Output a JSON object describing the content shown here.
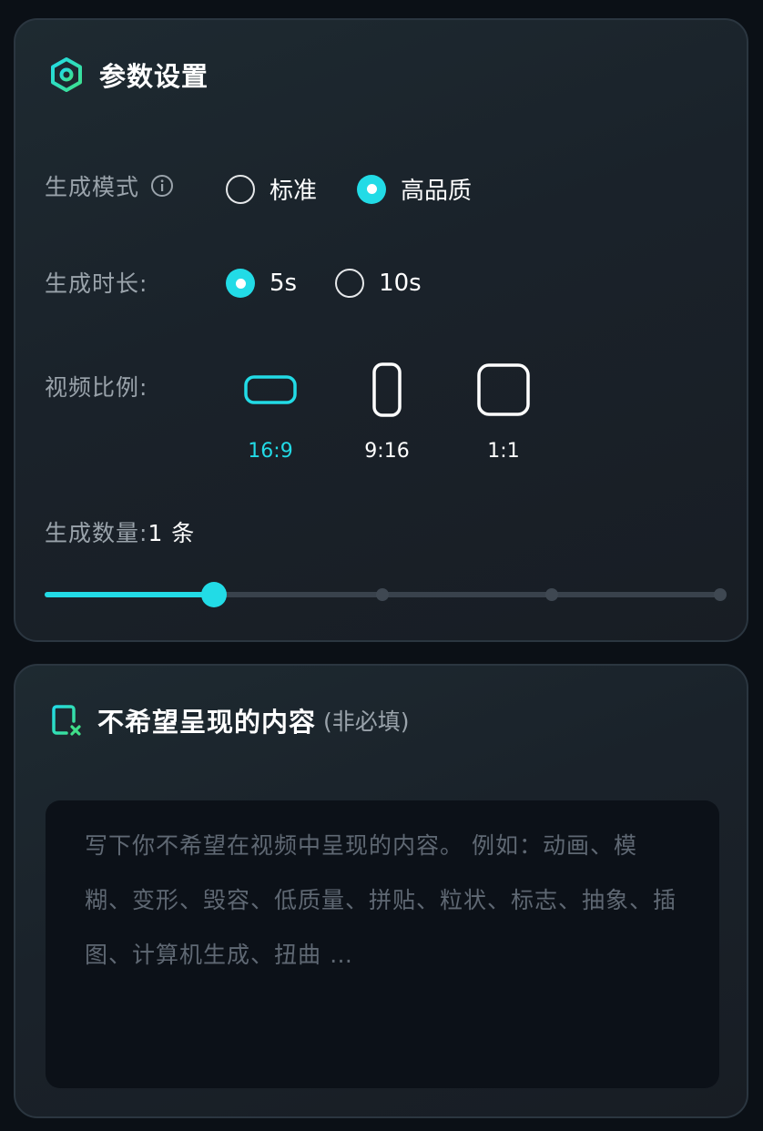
{
  "params": {
    "title": "参数设置",
    "mode": {
      "label": "生成模式",
      "options": [
        "标准",
        "高品质"
      ],
      "selected": "高品质"
    },
    "duration": {
      "label": "生成时长:",
      "options": [
        "5s",
        "10s"
      ],
      "selected": "5s"
    },
    "aspect_ratio": {
      "label": "视频比例:",
      "options": [
        "16:9",
        "9:16",
        "1:1"
      ],
      "selected": "16:9"
    },
    "count": {
      "label": "生成数量:",
      "value": "1 条",
      "slider_steps": 5,
      "slider_index": 1
    }
  },
  "negative": {
    "title": "不希望呈现的内容",
    "subtitle": "(非必填)",
    "placeholder": "写下你不希望在视频中呈现的内容。 例如：动画、模糊、变形、毁容、低质量、拼贴、粒状、标志、抽象、插图、计算机生成、扭曲 …"
  },
  "colors": {
    "accent": "#22dbe6",
    "card_bg": "#1c252d",
    "page_bg": "#0b1016"
  },
  "icons": {
    "params_header": "hexagon-settings-icon",
    "negative_header": "document-x-icon",
    "info": "info-icon"
  }
}
